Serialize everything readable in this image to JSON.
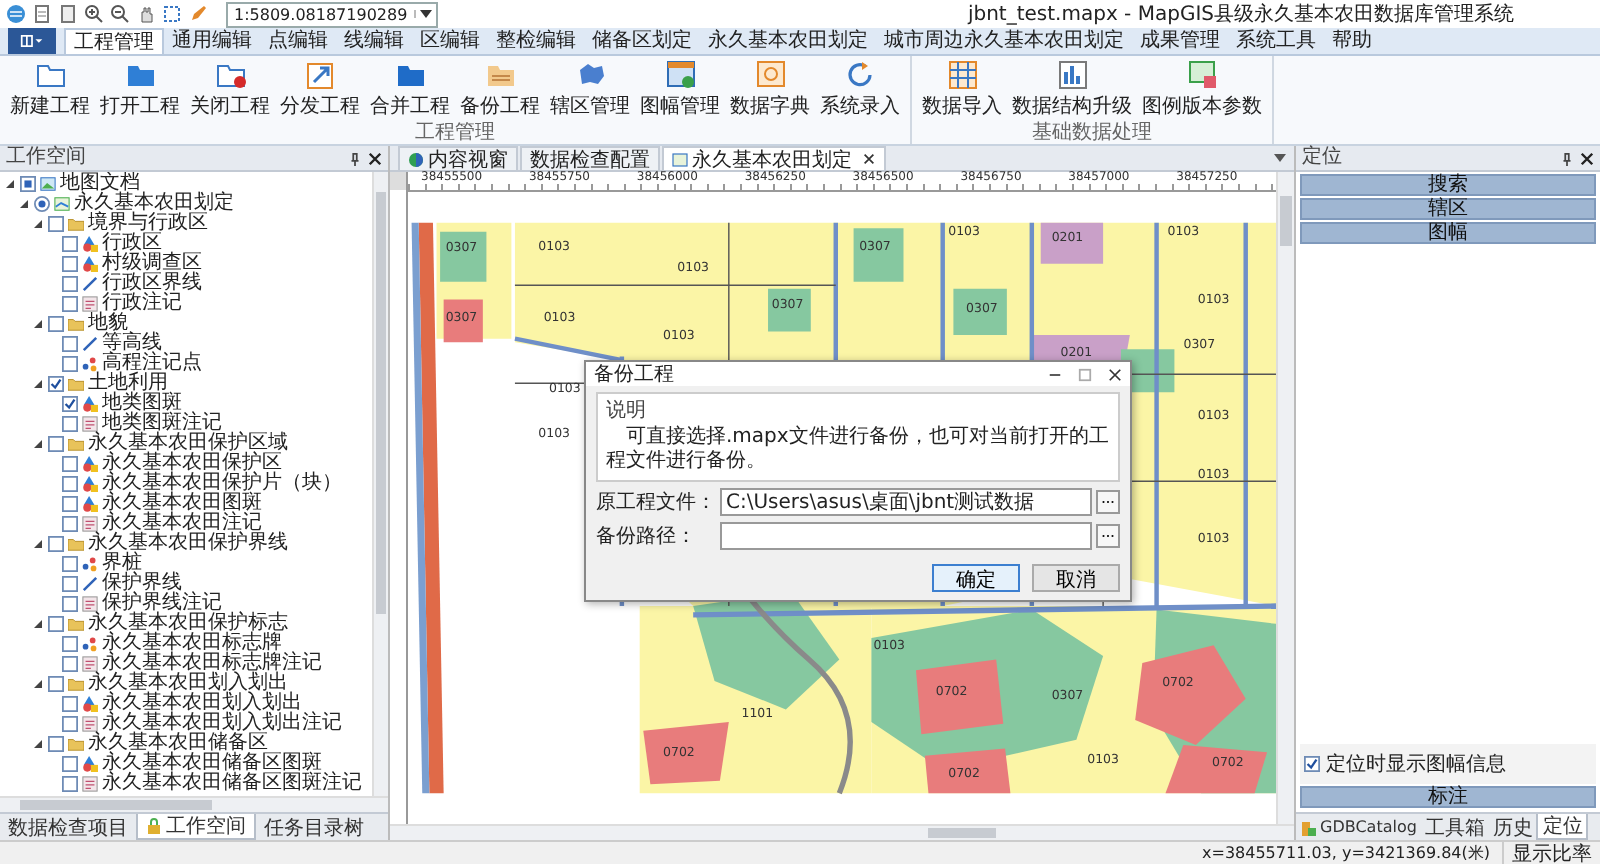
{
  "title_bar": {
    "scale": "1:5809.08187190289",
    "title": "jbnt_test.mapx - MapGIS县级永久基本农田数据库管理系统"
  },
  "menu_tabs": [
    {
      "label": "工程管理",
      "selected": true
    },
    {
      "label": "通用编辑",
      "selected": false
    },
    {
      "label": "点编辑",
      "selected": false
    },
    {
      "label": "线编辑",
      "selected": false
    },
    {
      "label": "区编辑",
      "selected": false
    },
    {
      "label": "整检编辑",
      "selected": false
    },
    {
      "label": "储备区划定",
      "selected": false
    },
    {
      "label": "永久基本农田划定",
      "selected": false
    },
    {
      "label": "城市周边永久基本农田划定",
      "selected": false
    },
    {
      "label": "成果管理",
      "selected": false
    },
    {
      "label": "系统工具",
      "selected": false
    },
    {
      "label": "帮助",
      "selected": false
    }
  ],
  "ribbon": {
    "groups": [
      {
        "label": "工程管理",
        "buttons": [
          "新建工程",
          "打开工程",
          "关闭工程",
          "分发工程",
          "合并工程",
          "备份工程",
          "辖区管理",
          "图幅管理",
          "数据字典",
          "系统录入"
        ]
      },
      {
        "label": "基础数据处理",
        "buttons": [
          "数据导入",
          "数据结构升级",
          "图例版本参数"
        ]
      }
    ]
  },
  "workspace": {
    "title": "工作空间",
    "tree": [
      {
        "label": "地图文档",
        "kind": "document",
        "checked": true,
        "expanded": true,
        "children": [
          {
            "label": "永久基本农田划定",
            "kind": "map",
            "checked": true,
            "expanded": true,
            "children": [
              {
                "label": "境界与行政区",
                "kind": "folder",
                "checked": false,
                "expanded": true,
                "children": [
                  {
                    "label": "行政区",
                    "kind": "region",
                    "checked": false
                  },
                  {
                    "label": "村级调查区",
                    "kind": "region",
                    "checked": false
                  },
                  {
                    "label": "行政区界线",
                    "kind": "line",
                    "checked": false
                  },
                  {
                    "label": "行政注记",
                    "kind": "note",
                    "checked": false
                  }
                ]
              },
              {
                "label": "地貌",
                "kind": "folder",
                "checked": false,
                "expanded": true,
                "children": [
                  {
                    "label": "等高线",
                    "kind": "line",
                    "checked": false
                  },
                  {
                    "label": "高程注记点",
                    "kind": "point",
                    "checked": false
                  }
                ]
              },
              {
                "label": "土地利用",
                "kind": "folder",
                "checked": true,
                "expanded": true,
                "children": [
                  {
                    "label": "地类图斑",
                    "kind": "region",
                    "checked": true
                  },
                  {
                    "label": "地类图斑注记",
                    "kind": "note",
                    "checked": false
                  }
                ]
              },
              {
                "label": "永久基本农田保护区域",
                "kind": "folder",
                "checked": false,
                "expanded": true,
                "children": [
                  {
                    "label": "永久基本农田保护区",
                    "kind": "region",
                    "checked": false
                  },
                  {
                    "label": "永久基本农田保护片（块）",
                    "kind": "region",
                    "checked": false
                  },
                  {
                    "label": "永久基本农田图斑",
                    "kind": "region",
                    "checked": false
                  },
                  {
                    "label": "永久基本农田注记",
                    "kind": "note",
                    "checked": false
                  }
                ]
              },
              {
                "label": "永久基本农田保护界线",
                "kind": "folder",
                "checked": false,
                "expanded": true,
                "children": [
                  {
                    "label": "界桩",
                    "kind": "point",
                    "checked": false
                  },
                  {
                    "label": "保护界线",
                    "kind": "line",
                    "checked": false
                  },
                  {
                    "label": "保护界线注记",
                    "kind": "note",
                    "checked": false
                  }
                ]
              },
              {
                "label": "永久基本农田保护标志",
                "kind": "folder",
                "checked": false,
                "expanded": true,
                "children": [
                  {
                    "label": "永久基本农田标志牌",
                    "kind": "point",
                    "checked": false
                  },
                  {
                    "label": "永久基本农田标志牌注记",
                    "kind": "note",
                    "checked": false
                  }
                ]
              },
              {
                "label": "永久基本农田划入划出",
                "kind": "folder",
                "checked": false,
                "expanded": true,
                "children": [
                  {
                    "label": "永久基本农田划入划出",
                    "kind": "region",
                    "checked": false
                  },
                  {
                    "label": "永久基本农田划入划出注记",
                    "kind": "note",
                    "checked": false
                  }
                ]
              },
              {
                "label": "永久基本农田储备区",
                "kind": "folder",
                "checked": false,
                "expanded": true,
                "children": [
                  {
                    "label": "永久基本农田储备区图斑",
                    "kind": "region",
                    "checked": false
                  },
                  {
                    "label": "永久基本农田储备区图斑注记",
                    "kind": "note",
                    "checked": false
                  }
                ]
              }
            ]
          }
        ]
      }
    ],
    "tabs": [
      {
        "label": "数据检查项目",
        "selected": false
      },
      {
        "label": "工作空间",
        "selected": true
      },
      {
        "label": "任务目录树",
        "selected": false
      }
    ]
  },
  "map_view": {
    "tabs": [
      {
        "label": "内容视窗",
        "selected": false
      },
      {
        "label": "数据检查配置",
        "selected": false
      },
      {
        "label": "永久基本农田划定",
        "selected": true
      }
    ],
    "ruler_ticks": [
      "38455500",
      "38455750",
      "38456000",
      "38456250",
      "38456500",
      "38456750",
      "38457000",
      "38457250"
    ],
    "parcels": [
      "0307",
      "0103",
      "0103",
      "0307",
      "0103",
      "0201",
      "0103",
      "0307",
      "0103",
      "0103",
      "0307",
      "0307",
      "0201",
      "0103",
      "0307",
      "0103",
      "0103",
      "0103",
      "0103",
      "0103",
      "0103",
      "0702",
      "1101",
      "0702",
      "0702",
      "0307",
      "0702",
      "0103",
      "0702"
    ]
  },
  "dialog": {
    "title": "备份工程",
    "section": "说明",
    "description": "可直接选择.mapx文件进行备份，也可对当前打开的工程文件进行备份。",
    "fields": [
      {
        "label": "原工程文件：",
        "value": "C:\\Users\\asus\\桌面\\jbnt测试数据"
      },
      {
        "label": "备份路径："
      }
    ],
    "buttons": [
      "确定",
      "取消"
    ]
  },
  "locate_panel": {
    "title": "定位",
    "sections": [
      "搜索",
      "辖区",
      "图幅"
    ],
    "option": {
      "label": "定位时显示图幅信息",
      "checked": true
    },
    "footer_section": "标注",
    "tabs": [
      {
        "label": "GDBCatalog",
        "selected": false
      },
      {
        "label": "工具箱",
        "selected": false
      },
      {
        "label": "历史",
        "selected": false
      },
      {
        "label": "定位",
        "selected": true
      }
    ]
  },
  "status_bar": {
    "coordinates": "x=38455711.03, y=3421369.84(米)",
    "scale_label": "显示比率"
  }
}
